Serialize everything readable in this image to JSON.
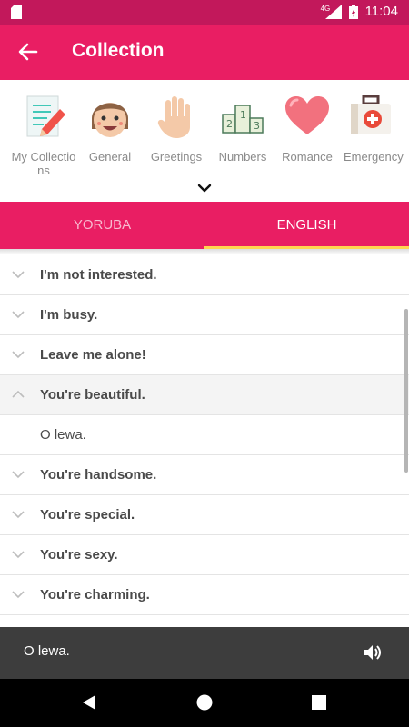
{
  "status_bar": {
    "network": "4G",
    "time": "11:04"
  },
  "app_bar": {
    "title": "Collection"
  },
  "categories": [
    {
      "label": "My Collections",
      "icon": "notepad-pencil-icon"
    },
    {
      "label": "General",
      "icon": "smiling-face-icon"
    },
    {
      "label": "Greetings",
      "icon": "waving-hand-icon"
    },
    {
      "label": "Numbers",
      "icon": "podium-123-icon"
    },
    {
      "label": "Romance",
      "icon": "heart-icon"
    },
    {
      "label": "Emergency",
      "icon": "first-aid-kit-icon"
    }
  ],
  "tabs": [
    {
      "label": "YORUBA",
      "selected": false
    },
    {
      "label": "ENGLISH",
      "selected": true
    }
  ],
  "phrases": [
    {
      "text": "I'm not interested.",
      "expanded": false
    },
    {
      "text": "I'm busy.",
      "expanded": false
    },
    {
      "text": "Leave me alone!",
      "expanded": false
    },
    {
      "text": "You're beautiful.",
      "expanded": true,
      "translation": "O lewa."
    },
    {
      "text": "You're handsome.",
      "expanded": false
    },
    {
      "text": "You're special.",
      "expanded": false
    },
    {
      "text": "You're sexy.",
      "expanded": false
    },
    {
      "text": "You're charming.",
      "expanded": false
    }
  ],
  "player": {
    "text": "O lewa."
  },
  "colors": {
    "primary": "#e91e63",
    "status_bar": "#c2185b",
    "tab_indicator": "#ffd54f",
    "player_bg": "#3d3d3d"
  }
}
